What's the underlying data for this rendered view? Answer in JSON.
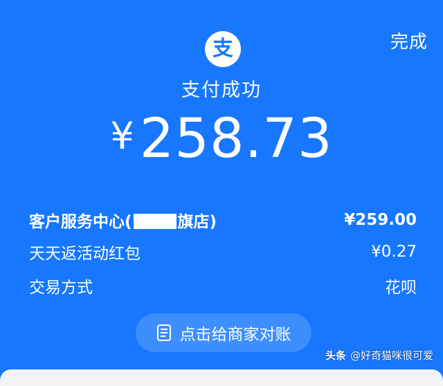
{
  "header": {
    "done_label": "完成"
  },
  "logo": {
    "glyph": "支",
    "icon": "alipay-logo-icon"
  },
  "status": {
    "title": "支付成功"
  },
  "amount": {
    "currency": "¥",
    "value": "258.73"
  },
  "details": {
    "rows": [
      {
        "label_prefix": "客户服务中心(",
        "label_suffix": "旗店)",
        "value": "¥259.00"
      },
      {
        "label": "天天返活动红包",
        "value": "¥0.27"
      },
      {
        "label": "交易方式",
        "value": "花呗"
      }
    ]
  },
  "reconcile": {
    "label": "点击给商家对账",
    "icon": "receipt-icon"
  },
  "watermark": {
    "brand": "头条",
    "text": "@好奇猫咪很可爱"
  },
  "colors": {
    "background": "#1777fe",
    "button": "#3d8efe",
    "text": "#ffffff"
  }
}
